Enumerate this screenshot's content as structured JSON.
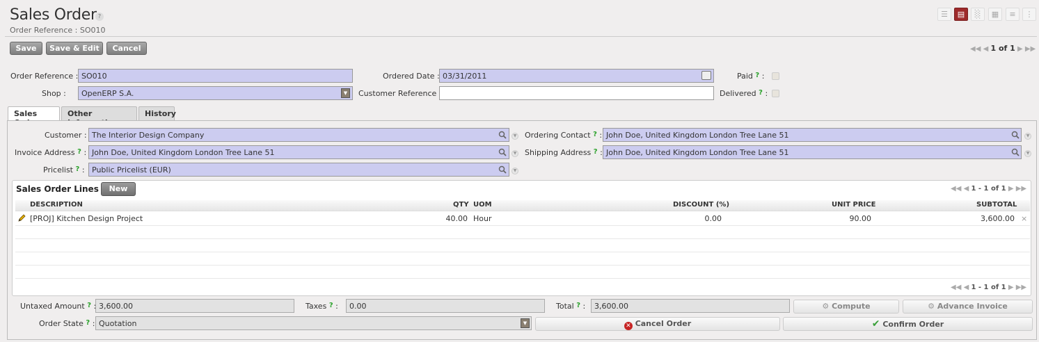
{
  "header": {
    "title": "Sales Order",
    "help": "?",
    "subtitle": "Order Reference : SO010"
  },
  "views": [
    "list-icon",
    "form-icon",
    "graph-icon",
    "calendar-icon",
    "gantt-icon",
    "kanban-icon"
  ],
  "toolbar": {
    "save_label": "Save",
    "save_edit_label": "Save & Edit",
    "cancel_label": "Cancel",
    "pager": "1 of 1"
  },
  "form": {
    "order_reference": {
      "label": "Order Reference :",
      "value": "SO010"
    },
    "ordered_date": {
      "label": "Ordered Date :",
      "value": "03/31/2011"
    },
    "paid": {
      "label": "Paid",
      "checked": false
    },
    "shop": {
      "label": "Shop :",
      "value": "OpenERP S.A."
    },
    "customer_reference": {
      "label": "Customer Reference :",
      "value": ""
    },
    "delivered": {
      "label": "Delivered",
      "checked": false
    },
    "colon": ":",
    "q": "?"
  },
  "tabs": [
    {
      "label": "Sales Order",
      "active": true
    },
    {
      "label": "Other Information",
      "active": false
    },
    {
      "label": "History",
      "active": false
    }
  ],
  "sales_order": {
    "customer": {
      "label": "Customer :",
      "value": "The Interior Design Company"
    },
    "ordering_contact": {
      "label": "Ordering Contact",
      "value": "John Doe, United Kingdom London Tree Lane 51"
    },
    "invoice_address": {
      "label": "Invoice Address",
      "value": "John Doe, United Kingdom London Tree Lane 51"
    },
    "shipping_address": {
      "label": "Shipping Address",
      "value": "John Doe, United Kingdom London Tree Lane 51"
    },
    "pricelist": {
      "label": "Pricelist",
      "value": "Public Pricelist (EUR)"
    }
  },
  "lines": {
    "title": "Sales Order Lines",
    "new_label": "New",
    "pager": "1 - 1 of 1",
    "columns": [
      "DESCRIPTION",
      "QTY",
      "UOM",
      "DISCOUNT (%)",
      "UNIT PRICE",
      "SUBTOTAL"
    ],
    "rows": [
      {
        "description": "[PROJ] Kitchen Design Project",
        "qty": "40.00",
        "uom": "Hour",
        "discount": "0.00",
        "unit_price": "90.00",
        "subtotal": "3,600.00",
        "delete": "×"
      }
    ]
  },
  "totals": {
    "untaxed": {
      "label": "Untaxed Amount",
      "value": "3,600.00"
    },
    "taxes": {
      "label": "Taxes",
      "value": "0.00"
    },
    "total": {
      "label": "Total",
      "value": "3,600.00"
    },
    "compute_label": "Compute",
    "advance_invoice_label": "Advance Invoice"
  },
  "state": {
    "label": "Order State",
    "value": "Quotation",
    "cancel_order_label": "Cancel Order",
    "confirm_order_label": "Confirm Order"
  },
  "colors": {
    "required_field": "#ccccf0",
    "active_view": "#9e2a2b",
    "help_mark": "#2aa12a"
  }
}
